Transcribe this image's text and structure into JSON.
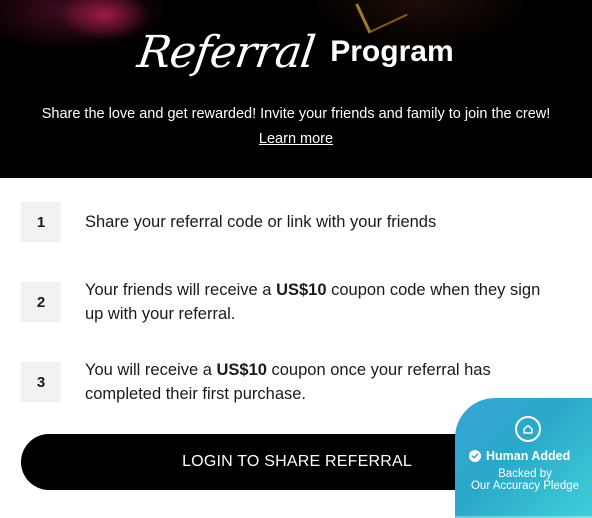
{
  "hero": {
    "title_script": "Referral",
    "title_bold": "Program",
    "subtitle": "Share the love and get rewarded! Invite your friends and family to join the crew!",
    "learn_more": "Learn more"
  },
  "steps": [
    {
      "number": "1",
      "text_before": "Share your referral code or link with your friends",
      "highlight": "",
      "text_after": ""
    },
    {
      "number": "2",
      "text_before": "Your friends will receive a ",
      "highlight": "US$10",
      "text_after": " coupon code when they sign up with your referral."
    },
    {
      "number": "3",
      "text_before": "You will receive a ",
      "highlight": "US$10",
      "text_after": " coupon once your referral has completed their first purchase."
    }
  ],
  "cta": {
    "label": "LOGIN TO SHARE REFERRAL"
  },
  "badge": {
    "title": "Human Added",
    "line1": "Backed by",
    "line2": "Our Accuracy Pledge",
    "icon": "home-icon",
    "check_icon": "check-icon",
    "color": "#2aa7c9"
  }
}
